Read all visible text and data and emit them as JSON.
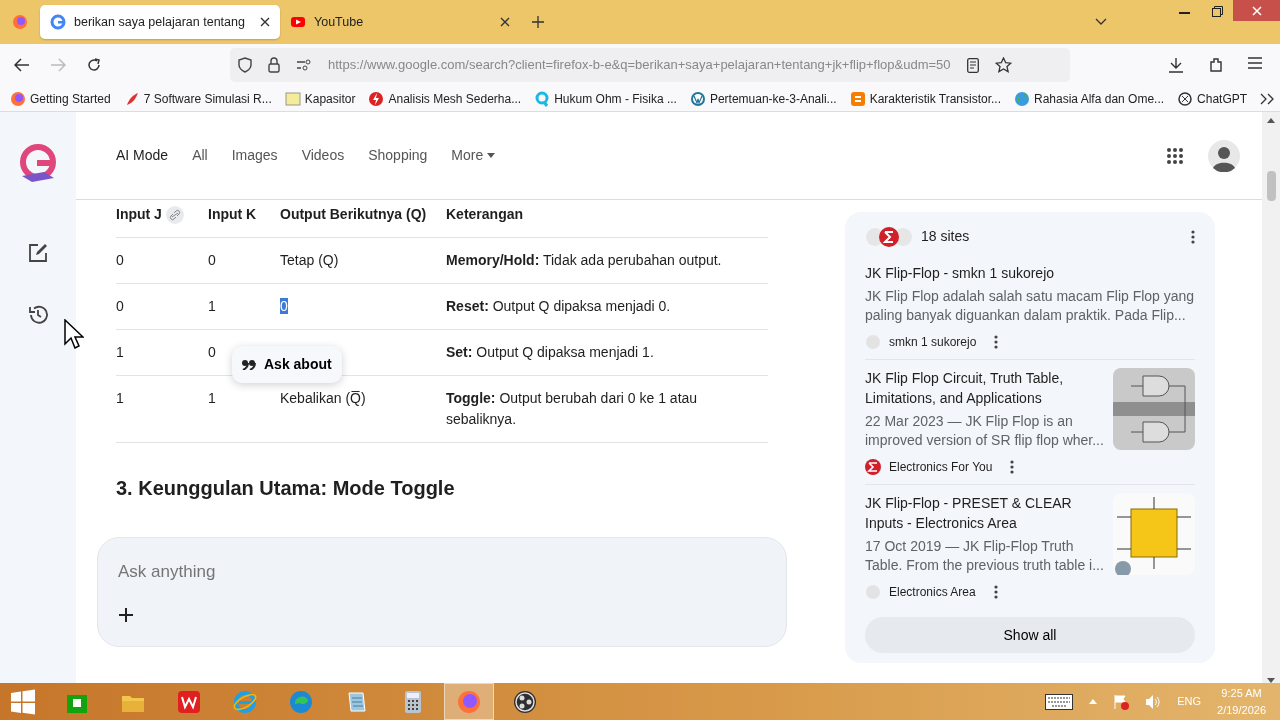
{
  "browser": {
    "tabs": [
      {
        "title": "berikan saya pelajaran tentang",
        "kind": "google",
        "selected": true
      },
      {
        "title": "YouTube",
        "kind": "youtube",
        "selected": false
      }
    ],
    "url": "https://www.google.com/search?client=firefox-b-e&q=berikan+saya+pelajaran+tentang+jk+flip+flop&udm=50",
    "bookmarks": [
      {
        "label": "Getting Started",
        "kind": "firefox"
      },
      {
        "label": "7 Software Simulasi R...",
        "kind": "leaf"
      },
      {
        "label": "Kapasitor",
        "kind": "square"
      },
      {
        "label": "Analisis Mesh Sederha...",
        "kind": "bolt"
      },
      {
        "label": "Hukum Ohm - Fisika ...",
        "kind": "q"
      },
      {
        "label": "Pertemuan-ke-3-Anali...",
        "kind": "wp"
      },
      {
        "label": "Karakteristik Transistor...",
        "kind": "blogger"
      },
      {
        "label": "Rahasia Alfa dan Ome...",
        "kind": "globe"
      },
      {
        "label": "ChatGPT",
        "kind": "knot"
      }
    ]
  },
  "search_tabs": [
    {
      "label": "AI Mode",
      "selected": true
    },
    {
      "label": "All",
      "selected": false
    },
    {
      "label": "Images",
      "selected": false
    },
    {
      "label": "Videos",
      "selected": false
    },
    {
      "label": "Shopping",
      "selected": false
    },
    {
      "label": "More",
      "selected": false,
      "dropdown": true
    }
  ],
  "table": {
    "columns": [
      "Input J",
      "Input K",
      "Output Berikutnya (Q)",
      "Keterangan"
    ],
    "rows": [
      {
        "j": "0",
        "k": "0",
        "output": "Tetap (Q)",
        "output_selected": false,
        "note": "**Memory/Hold:** Tidak ada perubahan output."
      },
      {
        "j": "0",
        "k": "1",
        "output": "0",
        "output_selected": true,
        "note": "**Reset:** Output Q dipaksa menjadi 0."
      },
      {
        "j": "1",
        "k": "0",
        "note": "**Set:** Output Q dipaksa menjadi 1."
      },
      {
        "j": "1",
        "k": "1",
        "output": "Kebalikan (Q̅)",
        "output_selected": false,
        "note": "**Toggle:** Output berubah dari 0 ke 1 atau sebaliknya."
      }
    ]
  },
  "popover": {
    "label": "Ask about"
  },
  "heading": "3. Keunggulan Utama: Mode Toggle",
  "ask_box": {
    "placeholder": "Ask anything"
  },
  "sources": {
    "count": "18 sites",
    "items": [
      {
        "title": "JK Flip-Flop - smkn 1 sukorejo",
        "snippet": "JK Flip Flop adalah salah satu macam Flip Flop yang paling banyak diguankan dalam praktik. Pada Flip...",
        "source": "smkn 1 sukorejo",
        "kind": "globe"
      },
      {
        "title": "JK Flip Flop Circuit, Truth Table, Limitations, and Applications",
        "snippet": "22 Mar 2023 — JK Flip Flop is an improved version of SR flip flop wher...",
        "source": "Electronics For You",
        "kind": "sigma"
      },
      {
        "title": "JK Flip-Flop - PRESET & CLEAR Inputs - Electronics Area",
        "snippet": "17 Oct 2019 — JK Flip-Flop Truth Table. From the previous truth table i...",
        "source": "Electronics Area",
        "kind": "globe"
      }
    ],
    "button": "Show all"
  },
  "taskbar": {
    "apps": [
      {
        "kind": "store",
        "active": false
      },
      {
        "kind": "folder",
        "active": false
      },
      {
        "kind": "wps",
        "active": false
      },
      {
        "kind": "ie",
        "active": false
      },
      {
        "kind": "edge",
        "active": false
      },
      {
        "kind": "notepad",
        "active": false
      },
      {
        "kind": "calculator",
        "active": false
      },
      {
        "kind": "firefox",
        "active": true
      },
      {
        "kind": "obs",
        "active": false
      }
    ],
    "language": "ENG",
    "time": "9:25 AM",
    "date": "2/19/2026"
  }
}
